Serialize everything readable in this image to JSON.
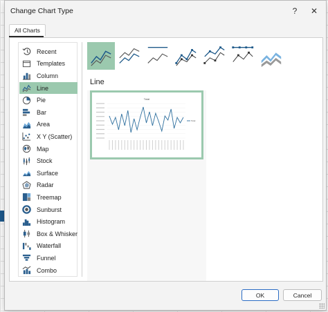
{
  "dialog": {
    "title": "Change Chart Type",
    "help_glyph": "?",
    "close_glyph": "✕"
  },
  "tabs": [
    {
      "label": "All Charts"
    }
  ],
  "chart_types": [
    {
      "label": "Recent",
      "icon": "recent-icon"
    },
    {
      "label": "Templates",
      "icon": "templates-icon"
    },
    {
      "label": "Column",
      "icon": "column-chart-icon"
    },
    {
      "label": "Line",
      "icon": "line-chart-icon",
      "selected": true
    },
    {
      "label": "Pie",
      "icon": "pie-chart-icon"
    },
    {
      "label": "Bar",
      "icon": "bar-chart-icon"
    },
    {
      "label": "Area",
      "icon": "area-chart-icon"
    },
    {
      "label": "X Y (Scatter)",
      "icon": "scatter-chart-icon"
    },
    {
      "label": "Map",
      "icon": "map-chart-icon"
    },
    {
      "label": "Stock",
      "icon": "stock-chart-icon"
    },
    {
      "label": "Surface",
      "icon": "surface-chart-icon"
    },
    {
      "label": "Radar",
      "icon": "radar-chart-icon"
    },
    {
      "label": "Treemap",
      "icon": "treemap-chart-icon"
    },
    {
      "label": "Sunburst",
      "icon": "sunburst-chart-icon"
    },
    {
      "label": "Histogram",
      "icon": "histogram-chart-icon"
    },
    {
      "label": "Box & Whisker",
      "icon": "box-whisker-chart-icon"
    },
    {
      "label": "Waterfall",
      "icon": "waterfall-chart-icon"
    },
    {
      "label": "Funnel",
      "icon": "funnel-chart-icon"
    },
    {
      "label": "Combo",
      "icon": "combo-chart-icon"
    }
  ],
  "subtypes": [
    {
      "icon": "line-subtype-icon",
      "selected": true
    },
    {
      "icon": "stacked-line-subtype-icon"
    },
    {
      "icon": "100-stacked-line-subtype-icon"
    },
    {
      "icon": "line-with-markers-subtype-icon"
    },
    {
      "icon": "stacked-line-markers-subtype-icon"
    },
    {
      "icon": "100-stacked-line-markers-subtype-icon"
    },
    {
      "icon": "3d-line-subtype-icon"
    }
  ],
  "selected_heading": "Line",
  "preview": {
    "title": "Total",
    "legend": "Total",
    "series_color": "#2e6f9e",
    "values": [
      32,
      20,
      30,
      12,
      35,
      18,
      40,
      8,
      28,
      12,
      30,
      45,
      22,
      38,
      18,
      36,
      24,
      10,
      32,
      26,
      42,
      14,
      30,
      22,
      30
    ]
  },
  "buttons": {
    "ok": "OK",
    "cancel": "Cancel"
  },
  "colors": {
    "accent_selected": "#9bc9ae",
    "primary_button_border": "#2a6cc4"
  }
}
